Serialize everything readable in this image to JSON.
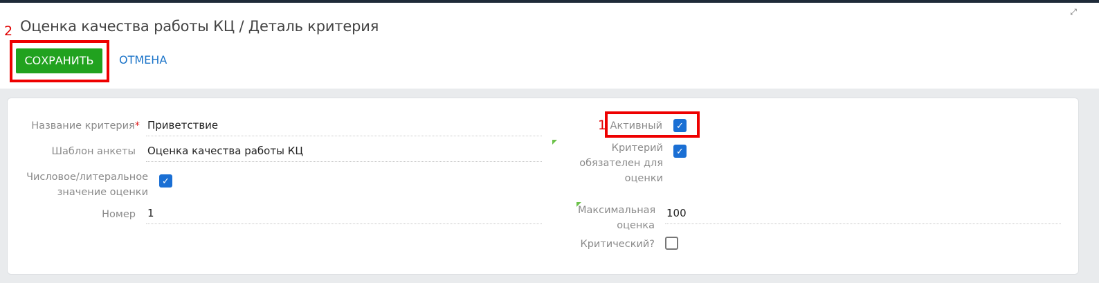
{
  "header": {
    "title": "Оценка качества работы КЦ / Деталь критерия",
    "save_label": "СОХРАНИТЬ",
    "cancel_label": "ОТМЕНА",
    "expand_icon": "expand-icon"
  },
  "annotations": {
    "marker_save": "2",
    "marker_active": "1",
    "highlight_color": "#ee0000"
  },
  "form": {
    "criterion_name": {
      "label": "Название критерия",
      "required_mark": "*",
      "value": "Приветствие"
    },
    "survey_template": {
      "label": "Шаблон анкеты",
      "value": "Оценка качества работы КЦ"
    },
    "numeric_literal": {
      "label": "Числовое/литеральное значение оценки",
      "checked": true
    },
    "number": {
      "label": "Номер",
      "value": "1"
    },
    "active": {
      "label": "Активный",
      "checked": true
    },
    "mandatory": {
      "label": "Критерий обязателен для оценки",
      "checked": true
    },
    "max_score": {
      "label": "Максимальная оценка",
      "value": "100"
    },
    "critical": {
      "label": "Критический?",
      "checked": false
    }
  },
  "colors": {
    "save_button": "#21a21f",
    "checkbox": "#1a6fd4",
    "link": "#1a73c8",
    "required": "#e02020"
  }
}
